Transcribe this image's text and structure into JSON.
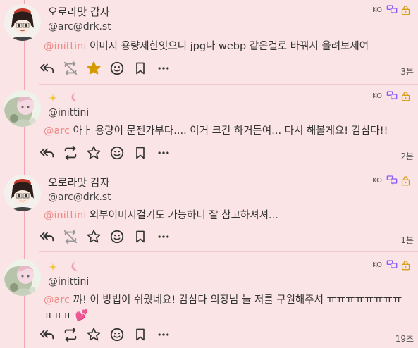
{
  "posts": [
    {
      "display_name": "오로라맛 감자",
      "handle": "@arc@drk.st",
      "lang": "KO",
      "mention": "@inittini",
      "text": " 이미지 용량제한잇으니 jpg나 webp 같은걸로 바꿔서 올려보세여",
      "time": "3분",
      "favorited": true,
      "avatar": "potato-avatar"
    },
    {
      "display_name": "",
      "name_emojis": [
        "star-sparkle-icon",
        "pink-moon-icon"
      ],
      "handle": "@inittini",
      "lang": "KO",
      "mention": "@arc",
      "text": " 아ㅏ 용량이 문젠가부다.... 이거 크긴 하거든여... 다시 해볼게요! 감삼다!!",
      "time": "2분",
      "favorited": false,
      "avatar": "inittini-avatar"
    },
    {
      "display_name": "오로라맛 감자",
      "handle": "@arc@drk.st",
      "lang": "KO",
      "mention": "@inittini",
      "text": " 외부이미지걸기도 가능하니 잘 참고하셔셔...",
      "time": "1분",
      "favorited": false,
      "avatar": "potato-avatar"
    },
    {
      "display_name": "",
      "name_emojis": [
        "star-sparkle-icon",
        "pink-moon-icon"
      ],
      "handle": "@inittini",
      "lang": "KO",
      "mention": "@arc",
      "text": " 꺄! 이 방법이 쉬웠네요! 감삼다 의장님 늘 저를 구원해주셔 ㅠㅠㅠㅠㅠㅠㅠㅠㅠㅠㅠ",
      "text_suffix": "💕",
      "time": "19초",
      "favorited": false,
      "avatar": "inittini-avatar"
    }
  ],
  "colors": {
    "background": "#fbe4e6",
    "accent": "#8b5cf6",
    "mention": "#ee8a87",
    "star_active": "#d49a00",
    "thread_line": "#f2a7b3"
  }
}
